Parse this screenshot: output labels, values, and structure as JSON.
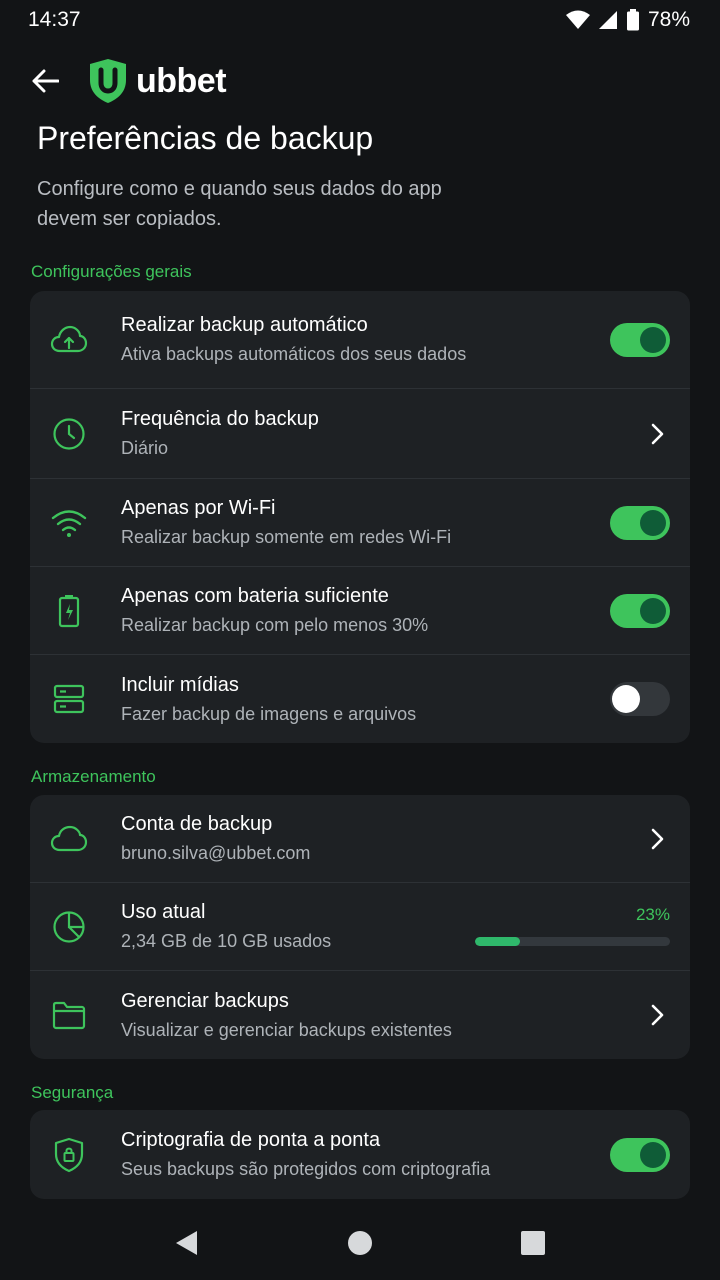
{
  "status": {
    "time": "14:37",
    "battery": "78%"
  },
  "app": {
    "logo_text": "ubbet",
    "logo_letter": "U"
  },
  "page": {
    "title": "Preferências de backup",
    "subtitle": "Configure como e quando seus dados do app devem ser copiados."
  },
  "sections": {
    "general": {
      "label": "Configurações gerais",
      "rows": [
        {
          "title": "Realizar backup automático",
          "subtitle": "Ativa backups automáticos dos seus dados",
          "icon": "cloud-upload-icon",
          "control": "toggle",
          "on": true
        },
        {
          "title": "Frequência do backup",
          "subtitle": "Diário",
          "icon": "clock-icon",
          "control": "chevron"
        },
        {
          "title": "Apenas por Wi-Fi",
          "subtitle": "Realizar backup somente em redes Wi-Fi",
          "icon": "wifi-icon",
          "control": "toggle",
          "on": true
        },
        {
          "title": "Apenas com bateria suficiente",
          "subtitle": "Realizar backup com pelo menos 30%",
          "icon": "battery-charging-icon",
          "control": "toggle",
          "on": true
        },
        {
          "title": "Incluir mídias",
          "subtitle": "Fazer backup de imagens e arquivos",
          "icon": "storage-icon",
          "control": "toggle",
          "on": false
        }
      ]
    },
    "storage": {
      "label": "Armazenamento",
      "rows": [
        {
          "title": "Conta de backup",
          "subtitle": "bruno.silva@ubbet.com",
          "icon": "cloud-icon",
          "control": "chevron"
        },
        {
          "title": "Uso atual",
          "subtitle": "2,34 GB de 10 GB usados",
          "icon": "pie-chart-icon",
          "control": "usage",
          "percent_label": "23%",
          "percent": 23
        },
        {
          "title": "Gerenciar backups",
          "subtitle": "Visualizar e gerenciar backups existentes",
          "icon": "folder-icon",
          "control": "chevron"
        }
      ]
    },
    "security": {
      "label": "Segurança",
      "rows": [
        {
          "title": "Criptografia de ponta a ponta",
          "subtitle": "Seus backups são protegidos com criptografia",
          "icon": "shield-lock-icon",
          "control": "toggle",
          "on": true
        }
      ]
    }
  },
  "colors": {
    "accent": "#3ec45c",
    "background": "#121416",
    "card": "#1e2124",
    "toggle_knob_on": "#0f5c37"
  }
}
